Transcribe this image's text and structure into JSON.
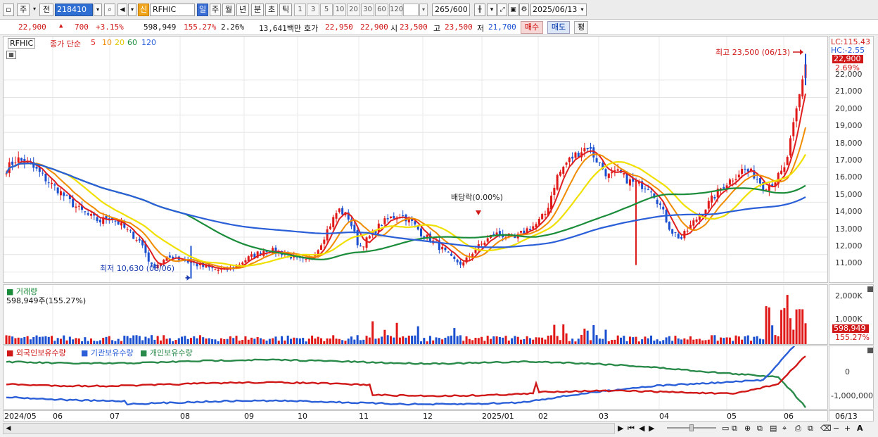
{
  "toolbar": {
    "type_label": "주",
    "prev_label": "전",
    "stock_code": "218410",
    "new_badge": "신",
    "stock_name": "RFHIC",
    "period_tabs": [
      "일",
      "주",
      "월",
      "년",
      "분",
      "초",
      "틱"
    ],
    "intervals": [
      "1",
      "3",
      "5",
      "10",
      "20",
      "30",
      "60",
      "120"
    ],
    "count_value": "265",
    "count_total": "/600",
    "date_value": "2025/06/13"
  },
  "quote": {
    "price": "22,900",
    "change_arrow": "▲",
    "change": "700",
    "change_pct": "+3.15%",
    "volume": "598,949",
    "volume_ratio": "155.27%",
    "turnover": "2.26%",
    "amount": "13,641백만",
    "ask_label": "호가",
    "ask1": "22,950",
    "ask2": "22,900",
    "open_label": "시",
    "open": "23,500",
    "high_label": "고",
    "high": "23,500",
    "low_label": "저",
    "low": "21,700",
    "buy_label": "매수",
    "sell_label": "매도",
    "eval_label": "평"
  },
  "price_panel": {
    "symbol": "RFHIC",
    "ma_title": "종가 단순",
    "ma_periods": [
      "5",
      "10",
      "20",
      "60",
      "120"
    ],
    "ma_colors": [
      "#e02020",
      "#f08c00",
      "#f0e000",
      "#1a8c3a",
      "#2a5fd8"
    ],
    "y_ticks": [
      "22,000",
      "21,000",
      "20,000",
      "19,000",
      "18,000",
      "17,000",
      "16,000",
      "15,000",
      "14,000",
      "13,000",
      "12,000",
      "11,000"
    ],
    "lc_label": "LC:115.43",
    "hc_label": "HC:-2.55",
    "current_price_box": "22,900",
    "current_pct": "2.69%",
    "annotation_high": "최고 23,500 (06/13)",
    "annotation_low": "최저 10,630 (08/06)",
    "annotation_dividend": "배당락(0.00%)"
  },
  "volume_panel": {
    "title": "거래량",
    "summary": "598,949주(155.27%)",
    "y_ticks": [
      "2,000K",
      "1,000K"
    ],
    "current_box": "598,949",
    "current_pct": "155.27%"
  },
  "holding_panel": {
    "legend": [
      "외국인보유수량",
      "기관보유수량",
      "개인보유수량"
    ],
    "legend_colors": [
      "#d01818",
      "#2a5fd8",
      "#2a8a4a"
    ],
    "y_ticks": [
      "0",
      "-1,000,000"
    ]
  },
  "x_axis": {
    "labels": [
      "2024/05",
      "06",
      "07",
      "08",
      "09",
      "10",
      "11",
      "12",
      "2025/01",
      "02",
      "03",
      "04",
      "05",
      "06"
    ],
    "end_label": "06/13"
  },
  "chart_data": {
    "type": "candlestick",
    "period": "daily",
    "x_start": "2024/05",
    "x_end": "2025/06/13",
    "ylim": [
      10500,
      23600
    ],
    "close_trace": [
      16900,
      17500,
      17200,
      16800,
      16200,
      15700,
      15100,
      14600,
      14200,
      13900,
      14200,
      13700,
      13200,
      12700,
      11300,
      11600,
      11900,
      11700,
      11500,
      11300,
      11150,
      11100,
      11300,
      11700,
      12000,
      12300,
      12150,
      12050,
      11700,
      11600,
      12300,
      13500,
      14600,
      14100,
      12400,
      13000,
      13700,
      14100,
      14300,
      13900,
      13200,
      12800,
      12300,
      11700,
      11450,
      12200,
      12700,
      13200,
      13100,
      12900,
      13400,
      13700,
      14400,
      16400,
      17300,
      17800,
      18200,
      17300,
      16500,
      16700,
      16200,
      16000,
      15900,
      14800,
      13400,
      12900,
      13700,
      14400,
      15200,
      15900,
      16400,
      16900,
      16600,
      15900,
      16200,
      16900,
      19800,
      22900
    ]
  }
}
